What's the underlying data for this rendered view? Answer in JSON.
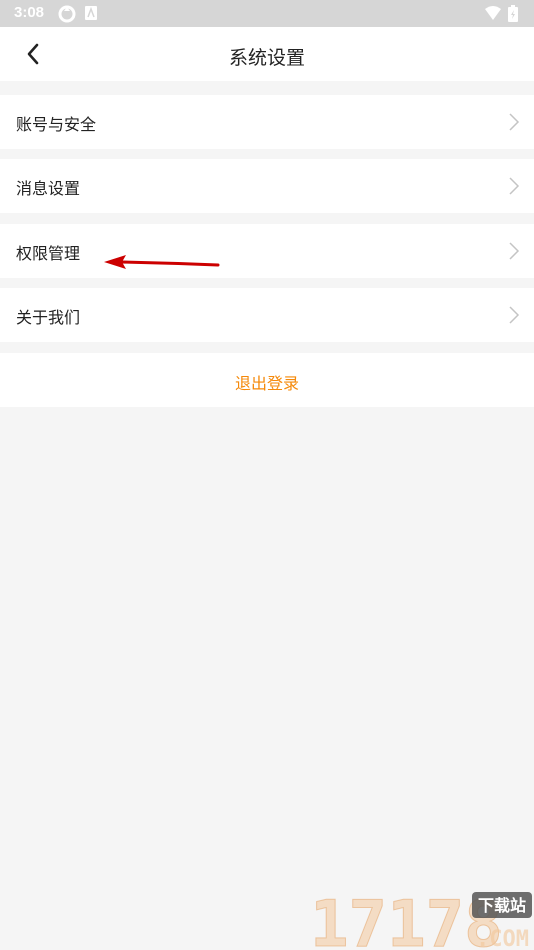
{
  "status_bar": {
    "time": "3:08"
  },
  "header": {
    "title": "系统设置"
  },
  "menu": {
    "items": [
      {
        "label": "账号与安全"
      },
      {
        "label": "消息设置"
      },
      {
        "label": "权限管理"
      },
      {
        "label": "关于我们"
      }
    ]
  },
  "logout": {
    "label": "退出登录"
  },
  "watermark": {
    "text": "17178",
    "sub": "下载站",
    "domain": ".COM"
  },
  "colors": {
    "accent": "#f5890a",
    "arrow": "#cc0000"
  }
}
